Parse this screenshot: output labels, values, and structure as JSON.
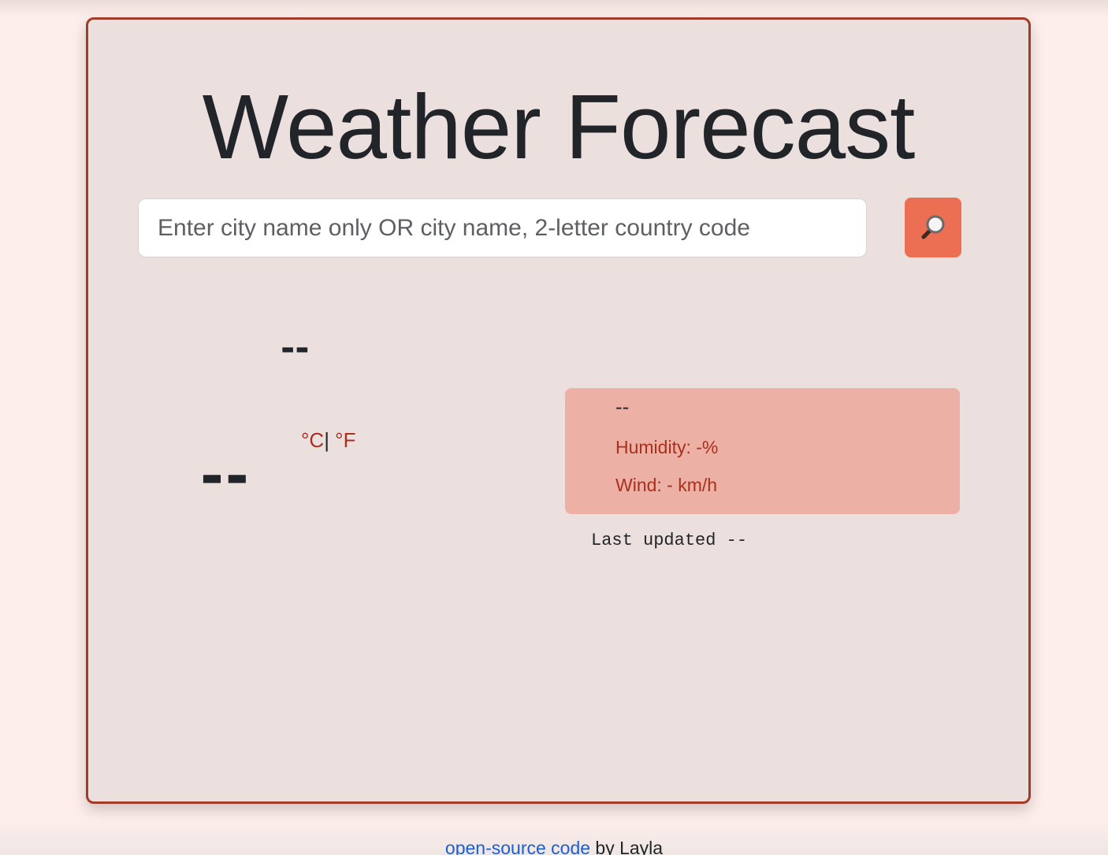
{
  "page": {
    "title": "Weather Forecast"
  },
  "search": {
    "placeholder": "Enter city name only OR city name, 2-letter country code",
    "value": "",
    "button_icon": "magnifying-glass-icon"
  },
  "current": {
    "city": "--",
    "temperature": "--",
    "unit_celsius": "°C",
    "unit_separator": "|",
    "unit_fahrenheit": " °F",
    "description": "--",
    "humidity": "Humidity: -%",
    "wind": "Wind: - km/h",
    "last_updated": "Last updated --"
  },
  "footer": {
    "link_text": "open-source code",
    "suffix": " by Layla"
  },
  "colors": {
    "page_background": "#fdeeeb",
    "card_background": "#ece0df",
    "card_border": "#a23b2a",
    "accent_button": "#ec6e53",
    "details_background": "#ecb0a4",
    "accent_text": "#a9301f",
    "link": "#1a5fd6"
  }
}
